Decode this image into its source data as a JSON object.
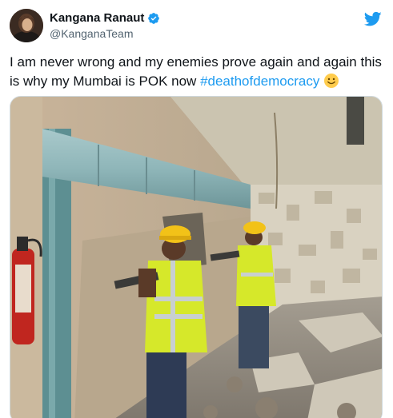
{
  "tweet": {
    "display_name": "Kangana Ranaut",
    "handle": "@KanganaTeam",
    "text_main": "I am never wrong and my enemies prove again and again this is why my Mumbai is POK now ",
    "hashtag": "#deathofdemocracy",
    "emoji": "slightly-smiling-face",
    "verified": true
  },
  "icons": {
    "verified_badge": "verified-badge-icon",
    "platform_logo": "twitter-bird-icon"
  },
  "colors": {
    "link": "#1d9bf0",
    "verified": "#1d9bf0",
    "text": "#0f1419",
    "secondary": "#536471"
  }
}
